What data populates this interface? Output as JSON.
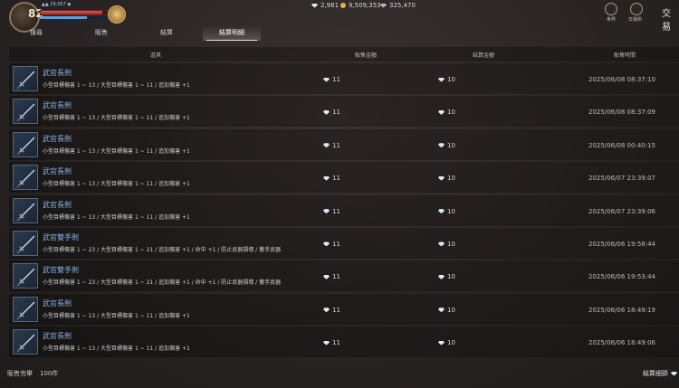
{
  "header": {
    "level": "82",
    "status_text": "▲▲ 29,567 ◆",
    "title": "交易",
    "currencies": [
      {
        "icon": "diamond-icon",
        "value": "2,981"
      },
      {
        "icon": "gold-coin-icon",
        "value": "9,509,353"
      },
      {
        "icon": "purple-gem-icon",
        "value": "325,470"
      }
    ],
    "icons": [
      {
        "icon": "world-icon",
        "label": "世界"
      },
      {
        "icon": "bag-icon",
        "label": "交易所"
      }
    ]
  },
  "tabs": [
    {
      "label": "搜尋",
      "active": false
    },
    {
      "label": "販售",
      "active": false
    },
    {
      "label": "結算",
      "active": false
    },
    {
      "label": "結算明細",
      "active": true
    }
  ],
  "table": {
    "columns": {
      "item": "道具",
      "sale_amount": "販售金額",
      "settle_amount": "結算金額",
      "sale_time": "販售時間"
    },
    "rows": [
      {
        "name": "武官長劍",
        "desc": "小型目標傷害 1 ~ 13 / 大型目標傷害 1 ~ 11 / 追加傷害 +1",
        "sale": "11",
        "settle": "10",
        "time": "2025/06/08 08:37:10"
      },
      {
        "name": "武官長劍",
        "desc": "小型目標傷害 1 ~ 13 / 大型目標傷害 1 ~ 11 / 追加傷害 +1",
        "sale": "11",
        "settle": "10",
        "time": "2025/06/08 08:37:09"
      },
      {
        "name": "武官長劍",
        "desc": "小型目標傷害 1 ~ 13 / 大型目標傷害 1 ~ 11 / 追加傷害 +1",
        "sale": "11",
        "settle": "10",
        "time": "2025/06/08 00:40:15"
      },
      {
        "name": "武官長劍",
        "desc": "小型目標傷害 1 ~ 13 / 大型目標傷害 1 ~ 11 / 追加傷害 +1",
        "sale": "11",
        "settle": "10",
        "time": "2025/06/07 23:39:07"
      },
      {
        "name": "武官長劍",
        "desc": "小型目標傷害 1 ~ 13 / 大型目標傷害 1 ~ 11 / 追加傷害 +1",
        "sale": "11",
        "settle": "10",
        "time": "2025/06/07 23:39:06"
      },
      {
        "name": "武官雙手劍",
        "desc": "小型目標傷害 1 ~ 23 / 大型目標傷害 1 ~ 21 / 追加傷害 +1 / 命中 +1 / 防止武器損壞 / 雙手武器",
        "sale": "11",
        "settle": "10",
        "time": "2025/06/06 19:58:44"
      },
      {
        "name": "武官雙手劍",
        "desc": "小型目標傷害 1 ~ 23 / 大型目標傷害 1 ~ 21 / 追加傷害 +1 / 命中 +1 / 防止武器損壞 / 雙手武器",
        "sale": "11",
        "settle": "10",
        "time": "2025/06/06 19:53:44"
      },
      {
        "name": "武官長劍",
        "desc": "小型目標傷害 1 ~ 13 / 大型目標傷害 1 ~ 11 / 追加傷害 +1",
        "sale": "11",
        "settle": "10",
        "time": "2025/06/06 18:49:19"
      },
      {
        "name": "武官長劍",
        "desc": "小型目標傷害 1 ~ 13 / 大型目標傷害 1 ~ 11 / 追加傷害 +1",
        "sale": "11",
        "settle": "10",
        "time": "2025/06/06 18:49:06"
      }
    ]
  },
  "footer": {
    "sold_label": "販售完畢",
    "sold_count": "100件",
    "settle_button": "結算細節"
  }
}
